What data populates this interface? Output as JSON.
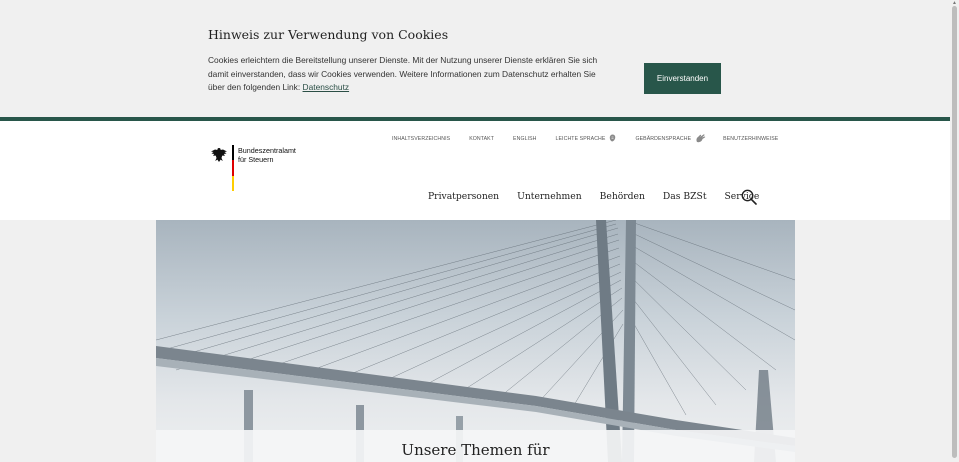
{
  "cookie_banner": {
    "title": "Hinweis zur Verwendung von Cookies",
    "text_line1": "Cookies erleichtern die Bereitstellung unserer Dienste. Mit der Nutzung unserer Dienste erklären Sie sich",
    "text_line2": "damit einverstanden, dass wir Cookies verwenden. Weitere Informationen zum Datenschutz erhalten Sie",
    "text_line3": "über den folgenden Link: ",
    "link_label": "Datenschutz",
    "accept_label": "Einverstanden"
  },
  "colors": {
    "brand_green": "#28564a"
  },
  "service_nav": [
    {
      "label": "INHALTSVERZEICHNIS"
    },
    {
      "label": "KONTAKT"
    },
    {
      "label": "ENGLISH"
    },
    {
      "label": "LEICHTE SPRACHE",
      "icon": "easy-language-icon"
    },
    {
      "label": "GEBÄRDENSPRACHE",
      "icon": "sign-language-icon"
    },
    {
      "label": "BENUTZERHINWEISE"
    }
  ],
  "logo": {
    "line1": "Bundeszentralamt",
    "line2": "für Steuern"
  },
  "main_nav": [
    {
      "label": "Privatpersonen"
    },
    {
      "label": "Unternehmen"
    },
    {
      "label": "Behörden"
    },
    {
      "label": "Das BZSt"
    },
    {
      "label": "Service"
    }
  ],
  "hero": {
    "title": "Unsere Themen für"
  }
}
